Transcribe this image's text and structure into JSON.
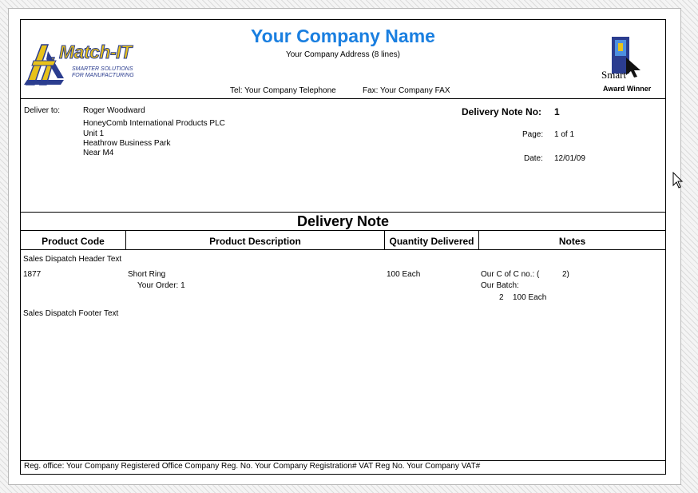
{
  "header": {
    "company_name": "Your Company Name",
    "company_address": "Your Company Address (8 lines)",
    "tel": "Tel: Your Company Telephone",
    "fax": "Fax: Your Company FAX",
    "logo_left": {
      "brand": "Match-IT",
      "tagline_1": "SMARTER SOLUTIONS",
      "tagline_2": "FOR MANUFACTURING"
    },
    "logo_right": {
      "brand": "Smart",
      "caption": "Award Winner"
    }
  },
  "delivery": {
    "deliver_to_label": "Deliver to:",
    "address_lines": [
      "Roger Woodward",
      "HoneyComb International Products PLC",
      "Unit 1",
      "Heathrow Business Park",
      "Near M4"
    ],
    "note_no_label": "Delivery Note No:",
    "note_no": "1",
    "page_label": "Page:",
    "page_value": "1 of 1",
    "date_label": "Date:",
    "date_value": "12/01/09"
  },
  "document_title": "Delivery Note",
  "table": {
    "columns": [
      "Product Code",
      "Product Description",
      "Quantity Delivered",
      "Notes"
    ],
    "header_text": "Sales Dispatch Header Text",
    "rows": [
      {
        "code": "1877",
        "description": "Short Ring",
        "order": "Your Order: 1",
        "quantity": "100 Each",
        "notes_coc": "Our C of C no.: (",
        "notes_coc_value": "2)",
        "notes_batch_label": "Our Batch:",
        "batch_number": "2",
        "batch_quantity": "100 Each"
      }
    ],
    "footer_text": "Sales Dispatch Footer Text"
  },
  "footer": {
    "registration": "Reg. office: Your Company Registered Office Company Reg. No. Your Company Registration# VAT Reg No. Your Company VAT#"
  },
  "colors": {
    "company_name": "#1a7fe0",
    "logo_gold": "#e8c21a",
    "logo_blue": "#2b3d8f"
  }
}
